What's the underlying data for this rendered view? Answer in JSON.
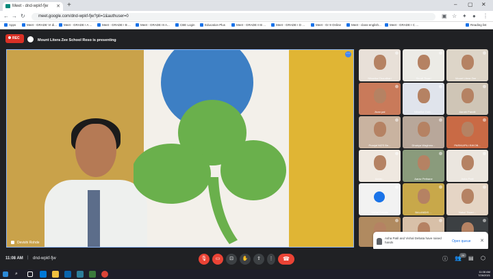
{
  "browser": {
    "tab_title": "Meet - dnd-wpkf-fjw",
    "url": "meet.google.com/dnd-wpkf-fjw?pli=1&authuser=0",
    "bookmarks": [
      "Apps",
      "Meet - GRADE VI di...",
      "Meet - GRADE I A ...",
      "Meet - GRADE I B ...",
      "Meet - GRADE III A...",
      "CBE Login",
      "Education Plus",
      "Meet - GRADE II B ...",
      "Meet - GRADE I D ...",
      "Meet - Gr 9 Online",
      "Meet - class-english...",
      "Meet - GRADE I C ...",
      "Reading list"
    ]
  },
  "meet": {
    "rec_label": "REC",
    "presenting_text": "Mount Litera Zee School Reso is presenting",
    "stage_name": "Devishi Rohde",
    "participants": [
      {
        "name": "Niharika Chaudhari",
        "bg": "#e8e0d8"
      },
      {
        "name": "Shruti Tiwari",
        "bg": "#ecebe6"
      },
      {
        "name": "Mount Litera Zee ...",
        "bg": "#ddd5c8"
      },
      {
        "name": "Jivan pal",
        "bg": "#c97a5a"
      },
      {
        "name": "Niharika Gaik...",
        "bg": "#e0e4ec"
      },
      {
        "name": "Aarohi Pandit",
        "bg": "#cfc5b6"
      },
      {
        "name": "Pranjal NIZS Be...",
        "bg": "#c9b3a0"
      },
      {
        "name": "Dhairya Waghmo...",
        "bg": "#b8a79a"
      },
      {
        "name": "PARIKAPILI BIKOB...",
        "bg": "#c96a45"
      },
      {
        "name": "Aarav...",
        "bg": "#efe8e0"
      },
      {
        "name": "Aarav Pethane",
        "bg": "#8a9b7c"
      },
      {
        "name": "Asha Patil",
        "bg": "#ebe6df"
      },
      {
        "name": "Vishal Debata",
        "bg": "#f2f2f2"
      },
      {
        "name": "BALANDIS ...",
        "bg": "#c8a84a"
      },
      {
        "name": "Nakul Tiwari...",
        "bg": "#e5d5c5"
      },
      {
        "name": "",
        "bg": "#b08a60"
      },
      {
        "name": "",
        "bg": "#d8c0a8"
      },
      {
        "name": "",
        "bg": "#3c4043"
      }
    ],
    "hand_popup": {
      "text": "Asha Patil and Vishal Debata have raised hands",
      "open_queue": "Open queue"
    },
    "time": "11:08 AM",
    "meeting_code": "dnd-wpkf-fjw",
    "participant_count": "29"
  },
  "taskbar": {
    "clock_time": "11:08 AM",
    "clock_date": "7/26/2021"
  },
  "colors": {
    "rec": "#d93025",
    "end_call": "#ea4335",
    "accent": "#1a73e8"
  }
}
